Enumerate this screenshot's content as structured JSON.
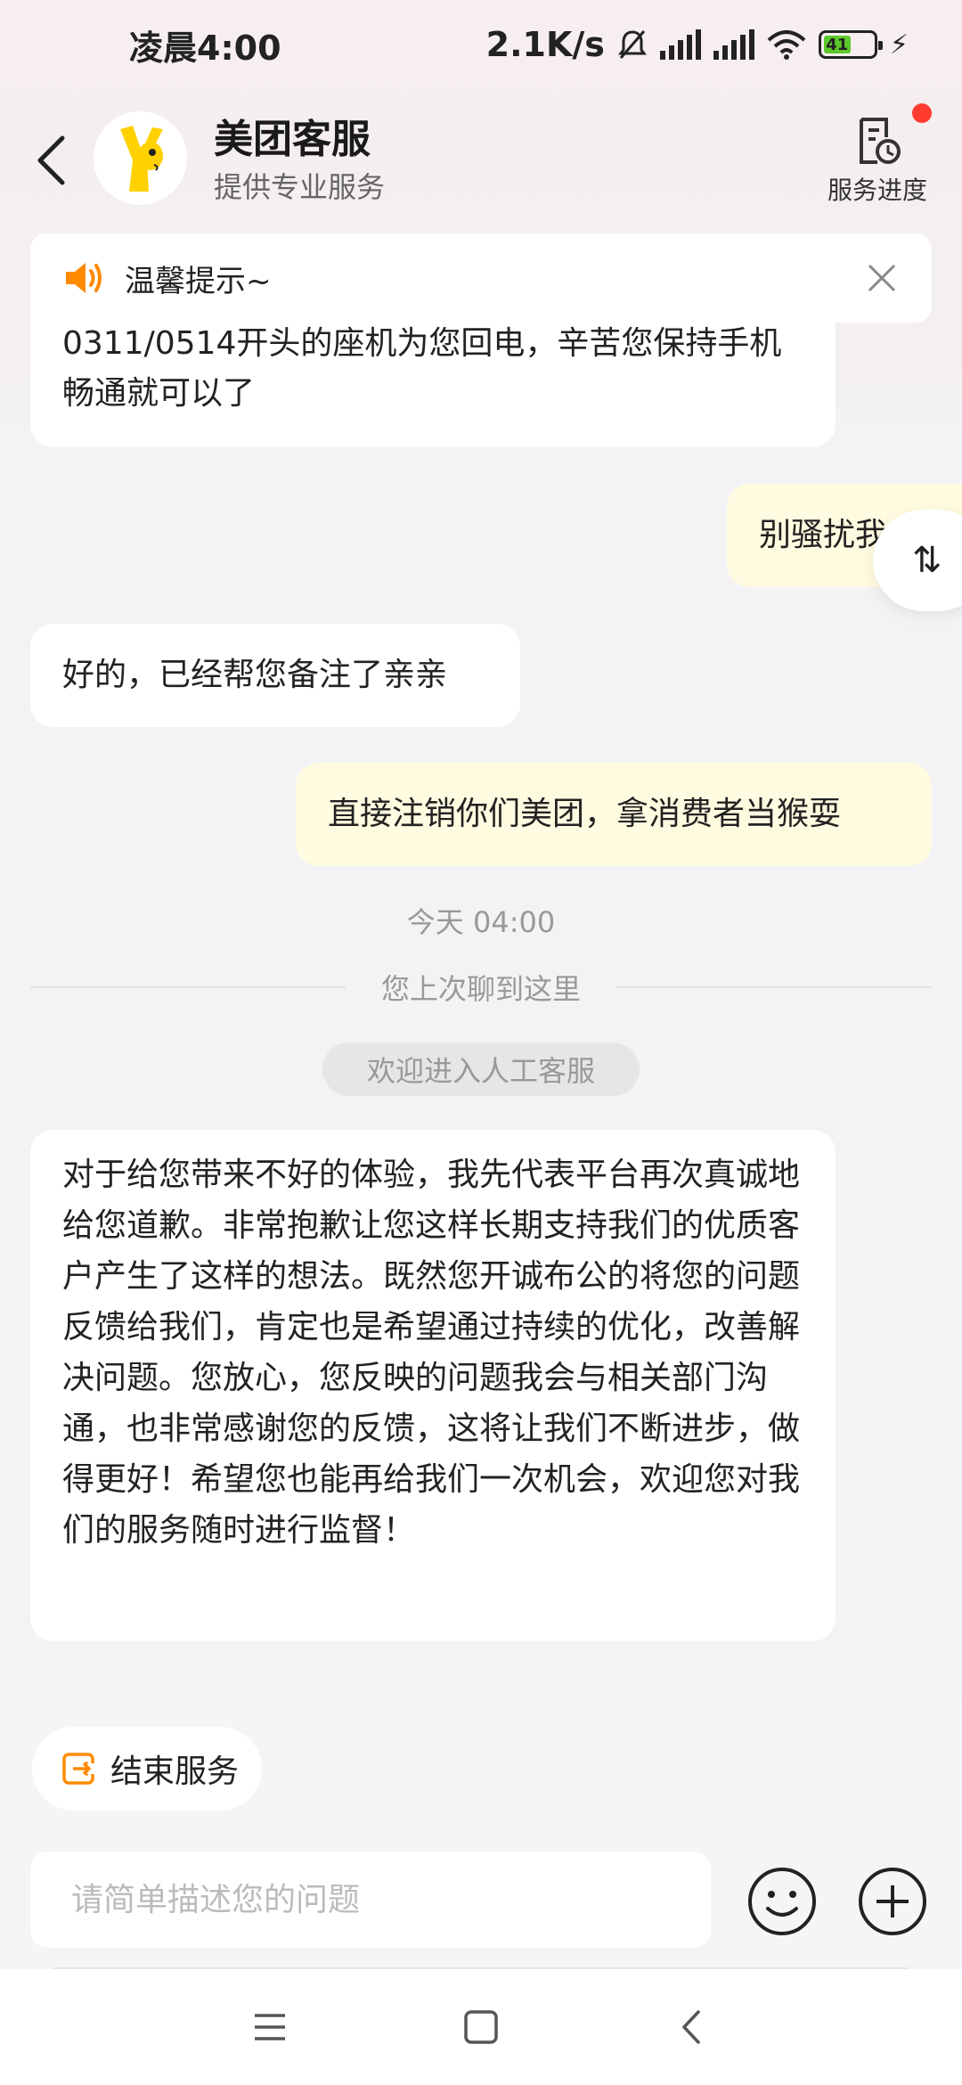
{
  "status_bar": {
    "time": "凌晨4:00",
    "network_speed": "2.1K/s",
    "battery_level": "41",
    "icons": [
      "mute-bell-icon",
      "hd-signal-icon",
      "hd-signal-icon",
      "wifi-icon",
      "battery-icon",
      "charging-icon"
    ]
  },
  "header": {
    "title": "美团客服",
    "subtitle": "提供专业服务",
    "progress_label": "服务进度",
    "has_notification": true
  },
  "notice": {
    "text": "温馨提示~"
  },
  "messages": [
    {
      "side": "left",
      "text": "0311/0514开头的座机为您回电，辛苦您保持手机畅通就可以了"
    },
    {
      "side": "right",
      "text": "别骚扰我"
    },
    {
      "side": "left",
      "text": "好的，已经帮您备注了亲亲"
    },
    {
      "side": "right",
      "text": "直接注销你们美团，拿消费者当猴耍"
    },
    {
      "side": "left",
      "text": "对于给您带来不好的体验，我先代表平台再次真诚地给您道歉。非常抱歉让您这样长期支持我们的优质客户产生了这样的想法。既然您开诚布公的将您的问题反馈给我们，肯定也是希望通过持续的优化，改善解决问题。您放心，您反映的问题我会与相关部门沟通，也非常感谢您的反馈，这将让我们不断进步，做得更好！希望您也能再给我们一次机会，欢迎您对我们的服务随时进行监督！"
    }
  ],
  "float_button": {
    "label": "⇅"
  },
  "timestamp": "今天 04:00",
  "last_read_divider": "您上次聊到这里",
  "system_notice": "欢迎进入人工客服",
  "bottom": {
    "end_service_label": "结束服务",
    "input_placeholder": "请简单描述您的问题"
  },
  "colors": {
    "accent_orange": "#ff8a00",
    "user_bubble": "#fffbe0",
    "notification_dot": "#ff3b30"
  }
}
